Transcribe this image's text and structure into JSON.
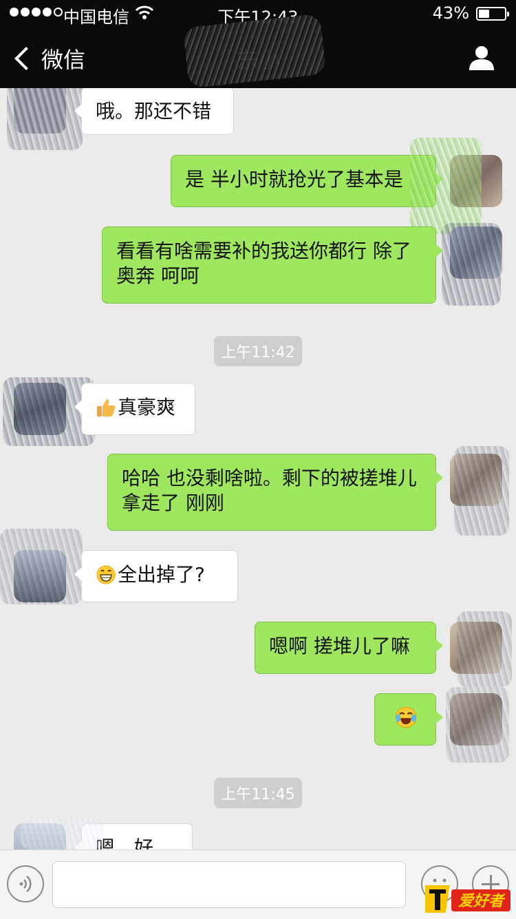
{
  "status_bar": {
    "carrier": "中国电信",
    "time": "下午12:43",
    "battery_pct": "43%",
    "battery_level": 0.43,
    "signal_bars_filled": 4,
    "signal_bars_total": 5
  },
  "nav": {
    "back_label": "微信",
    "title": "东小"
  },
  "messages": [
    {
      "side": "them",
      "text": "哦。那还不错"
    },
    {
      "side": "me",
      "text": "是 半小时就抢光了基本是"
    },
    {
      "side": "me",
      "text": "看看有啥需要补的我送你都行  除了奥奔 呵呵"
    },
    {
      "type": "timestamp",
      "text": "上午11:42"
    },
    {
      "side": "them",
      "emoji": "thumbs-up",
      "text": "真豪爽"
    },
    {
      "side": "me",
      "text": "哈哈 也没剩啥啦。剩下的被搓堆儿拿走了 刚刚"
    },
    {
      "side": "them",
      "emoji": "grinning",
      "text": "全出掉了?"
    },
    {
      "side": "me",
      "text": "嗯啊 搓堆儿了嘛"
    },
    {
      "side": "me",
      "emoji": "tears-of-joy",
      "text": ""
    },
    {
      "type": "timestamp",
      "text": "上午11:45"
    },
    {
      "side": "them",
      "text": "嗯，好"
    }
  ],
  "watermark": "爱好者",
  "colors": {
    "bubble_me": "#9ee75f",
    "bubble_them": "#ffffff",
    "background": "#ebebeb",
    "topbar": "#0a0a0a"
  }
}
